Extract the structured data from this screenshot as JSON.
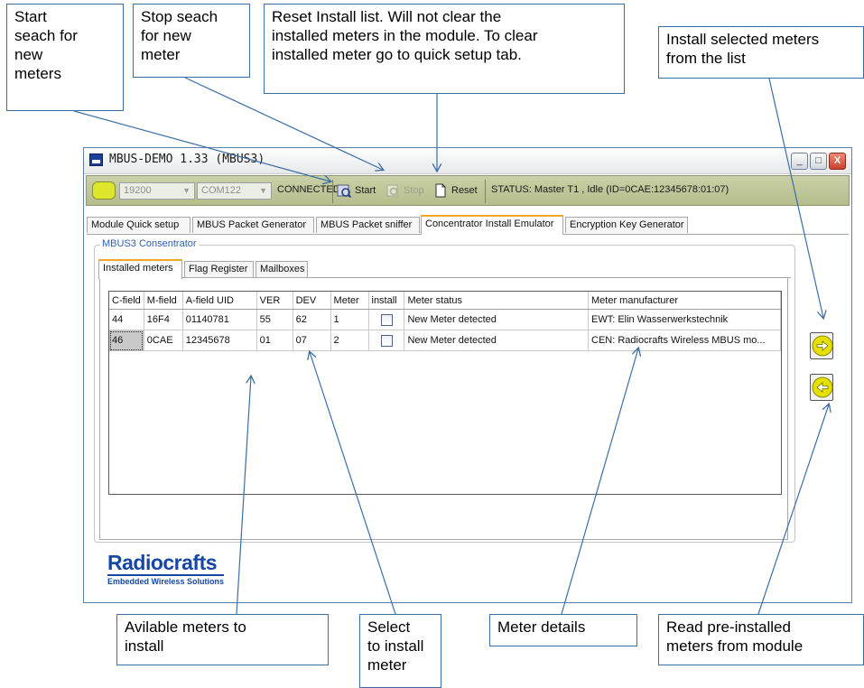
{
  "callouts": {
    "start": "Start\nseach for\nnew\nmeters",
    "stop": "Stop seach\nfor new\nmeter",
    "reset": "Reset Install list. Will not clear the\ninstalled meters in the module. To clear\ninstalled meter go to quick setup tab.",
    "install": "Install selected meters\nfrom  the list",
    "available": "Avilable meters to\ninstall",
    "select": "Select\nto install\nmeter",
    "details": "Meter details",
    "read": "Read pre-installed\nmeters from module"
  },
  "window": {
    "title": "MBUS-DEMO 1.33 (MBUS3)",
    "min_label": "_",
    "max_label": "□",
    "close_label": "X"
  },
  "toolbar": {
    "baud": "19200",
    "port": "COM122",
    "state": "CONNECTED",
    "start_label": "Start",
    "stop_label": "Stop",
    "reset_label": "Reset",
    "status": "STATUS: Master T1 , Idle  (ID=0CAE:12345678:01:07)"
  },
  "tabs": [
    "Module Quick setup",
    "MBUS Packet Generator",
    "MBUS Packet sniffer",
    "Concentrator Install Emulator",
    "Encryption Key Generator"
  ],
  "group_title": "MBUS3 Consentrator",
  "subtabs": [
    "Installed meters",
    "Flag Register",
    "Mailboxes"
  ],
  "table": {
    "columns": [
      "C-field",
      "M-field",
      "A-field UID",
      "VER",
      "DEV",
      "Meter",
      "install",
      "Meter status",
      "Meter manufacturer"
    ],
    "rows": [
      [
        "44",
        "16F4",
        "01140781",
        "55",
        "62",
        "1",
        "",
        "New Meter detected",
        "EWT: Elin Wasserwerkstechnik"
      ],
      [
        "46",
        "0CAE",
        "12345678",
        "01",
        "07",
        "2",
        "",
        "New Meter detected",
        "CEN: Radiocrafts Wireless MBUS mo..."
      ]
    ]
  },
  "logo": {
    "name": "Radiocrafts",
    "tagline": "Embedded Wireless Solutions"
  },
  "colors": {
    "toolbar": "#c0c79a",
    "active_tab_accent": "#f5a623",
    "arrow_button": "#e6e000",
    "logo": "#1747a6",
    "callout_line": "#3a6ea5"
  }
}
